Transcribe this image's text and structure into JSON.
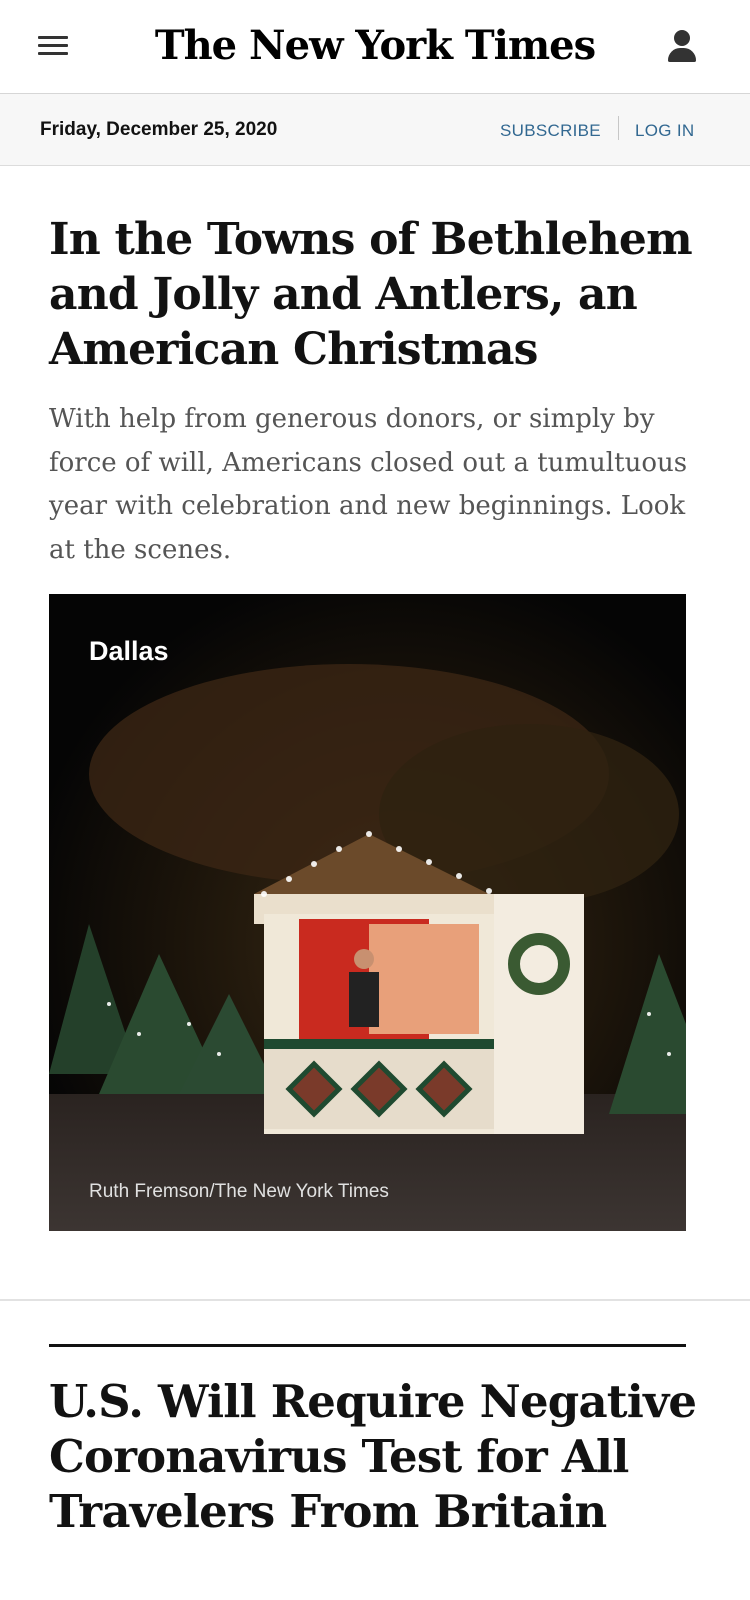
{
  "header": {
    "logo_text": "The New York Times",
    "menu_icon": "hamburger-menu-icon",
    "account_icon": "user-icon"
  },
  "datebar": {
    "date": "Friday, December 25, 2020",
    "subscribe_label": "SUBSCRIBE",
    "login_label": "LOG IN",
    "link_color": "#326891"
  },
  "stories": [
    {
      "headline": "In the Towns of Bethlehem and Jolly and Antlers, an American Christmas",
      "summary": "With help from generous donors, or simply by force of will, Americans closed out a tumultuous year with celebration and new beginnings. Look at the scenes.",
      "image": {
        "label": "Dallas",
        "credit": "Ruth Fremson/The New York Times"
      }
    },
    {
      "headline": "U.S. Will Require Negative Coronavirus Test for All Travelers From Britain"
    }
  ]
}
